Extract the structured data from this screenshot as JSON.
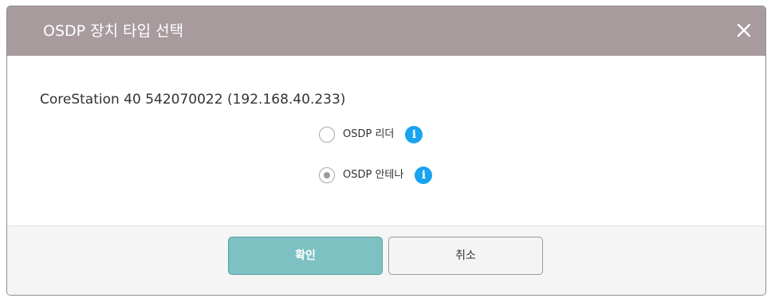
{
  "dialog": {
    "title": "OSDP 장치 타입 선택",
    "close_icon": "close-icon",
    "header_color": "#a79b9d",
    "device_label": "CoreStation 40 542070022 (192.168.40.233)",
    "options": [
      {
        "label": "OSDP 리더",
        "checked": false,
        "icon": "info-icon"
      },
      {
        "label": "OSDP 안테나",
        "checked": true,
        "icon": "info-icon"
      }
    ],
    "info_symbol": "i",
    "info_color": "#1aa3f0",
    "buttons": {
      "ok_label": "확인",
      "cancel_label": "취소",
      "ok_color": "#7ec1c3"
    }
  }
}
